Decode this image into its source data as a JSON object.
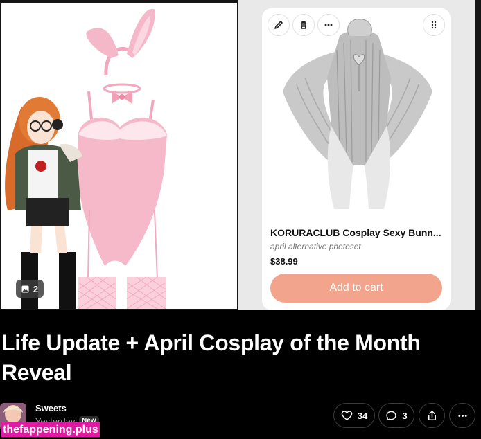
{
  "gallery": {
    "image_count": "2",
    "image_count_icon": "image-icon"
  },
  "product_card": {
    "name": "KORURACLUB Cosplay Sexy Bunn...",
    "subtitle": "april alternative photoset",
    "price": "$38.99",
    "cart_label": "Add to cart",
    "cart_color": "#f2a58c",
    "tools": [
      "pencil-icon",
      "trash-icon",
      "more-icon",
      "grip-icon"
    ]
  },
  "post": {
    "title": "Life Update + April Cosplay of the Month Reveal"
  },
  "author": {
    "name": "Sweets",
    "time": "Yesterday",
    "badge": "New"
  },
  "actions": {
    "likes": "34",
    "comments": "3"
  },
  "watermark": "thefappening.plus"
}
